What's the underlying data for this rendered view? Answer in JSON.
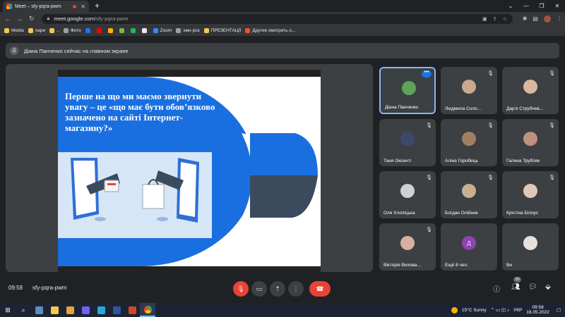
{
  "browser": {
    "tab_title": "Meet – sfy-pqra-pwm",
    "url_host": "meet.google.com",
    "url_path": "/sfy-pqra-pwm",
    "bookmarks": [
      {
        "label": "Media",
        "color": "#f2c94c"
      },
      {
        "label": "пари",
        "color": "#f2c94c"
      },
      {
        "label": "..",
        "color": "#f2c94c"
      },
      {
        "label": "Фото",
        "color": "#9aa0a6"
      },
      {
        "label": "",
        "color": "#1877f2"
      },
      {
        "label": "",
        "color": "#ff0000"
      },
      {
        "label": "",
        "color": "#ffb300"
      },
      {
        "label": "",
        "color": "#7ab648"
      },
      {
        "label": "",
        "color": "#1db954"
      },
      {
        "label": "",
        "color": "#e8eaed"
      },
      {
        "label": "Zoom",
        "color": "#2d8cff"
      },
      {
        "label": "эмн роз",
        "color": "#9aa0a6"
      },
      {
        "label": "ПРЕЗЕНТАЦІЇ",
        "color": "#f2c94c"
      },
      {
        "label": "Другие смотреть о...",
        "color": "#e8552d"
      }
    ]
  },
  "banner": {
    "avatar_letter": "Д",
    "text": "Діана Панченко сейчас на главном экране"
  },
  "slide": {
    "heading": "Перше на що ми маємо звернути увагу – це «що має бути обов’язково зазначено на сайті Інтернет-магазину?»",
    "brand_color": "#1a6fe0"
  },
  "participants": [
    {
      "name": "Діана Панченко",
      "active": true
    },
    {
      "name": "Людмила Соло...",
      "muted": true
    },
    {
      "name": "Дар'я Струбчев...",
      "muted": true
    },
    {
      "name": "Таня Оксенті",
      "muted": true
    },
    {
      "name": "Аліна Горобець",
      "muted": true
    },
    {
      "name": "Галина Трубляк",
      "muted": true
    },
    {
      "name": "Оля Хлопіцька",
      "muted": true
    },
    {
      "name": "Богдан Олійник",
      "muted": true
    },
    {
      "name": "Крістіна Білоус",
      "muted": true
    },
    {
      "name": "Вікторія Вихова...",
      "muted": true
    },
    {
      "name": "Ещё 8 чел.",
      "muted": false
    },
    {
      "name": "Ви",
      "muted": false
    }
  ],
  "more_letter": "Д",
  "controls": {
    "time": "09:58",
    "meeting_code": "sfy-pqra-pwm",
    "participants_count": "20"
  },
  "taskbar": {
    "weather": "15°C  Sunny",
    "lang": "УКР",
    "time": "09:58",
    "date": "16.05.2022"
  }
}
